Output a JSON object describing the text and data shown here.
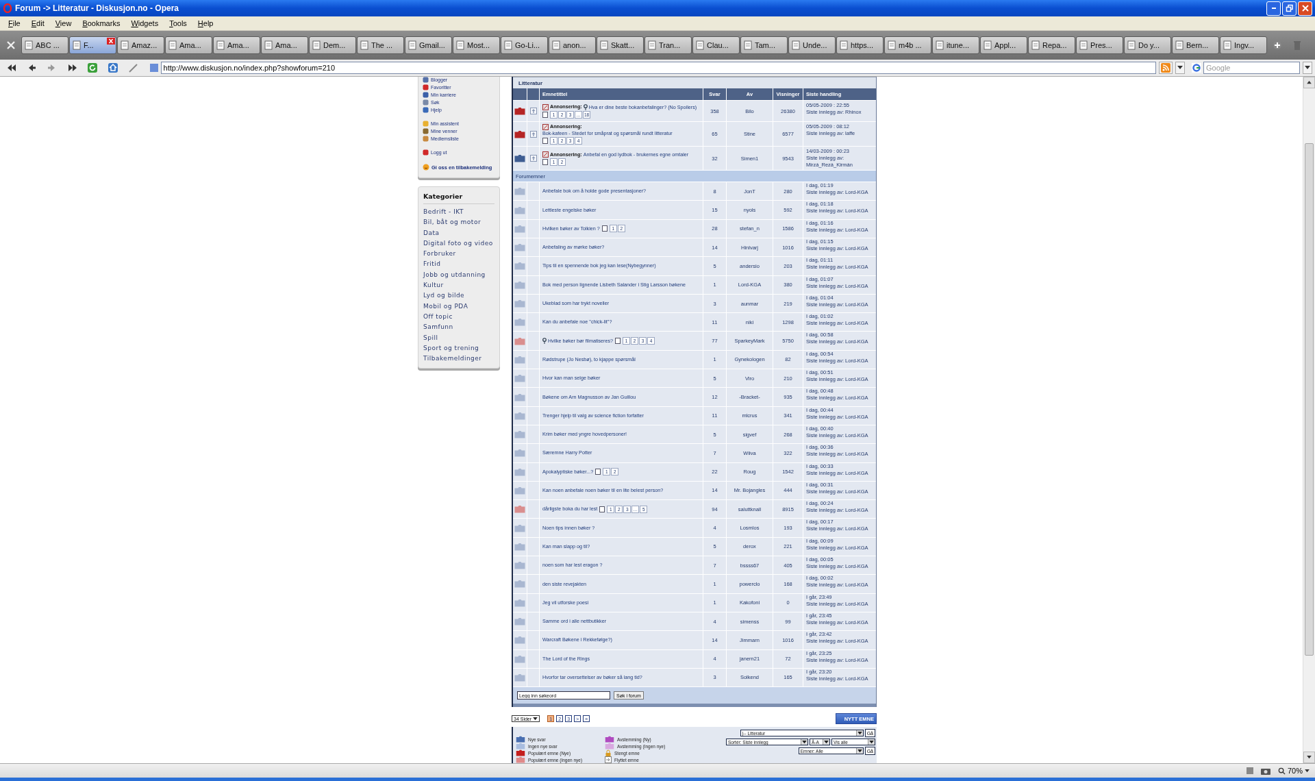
{
  "window": {
    "title": "Forum -> Litteratur - Diskusjon.no - Opera"
  },
  "menu": [
    "File",
    "Edit",
    "View",
    "Bookmarks",
    "Widgets",
    "Tools",
    "Help"
  ],
  "tabs": [
    {
      "label": "ABC ...",
      "selected": false
    },
    {
      "label": "F...",
      "selected": true
    },
    {
      "label": "Amaz...",
      "selected": false
    },
    {
      "label": "Ama...",
      "selected": false
    },
    {
      "label": "Ama...",
      "selected": false
    },
    {
      "label": "Ama...",
      "selected": false
    },
    {
      "label": "Dem...",
      "selected": false
    },
    {
      "label": "The ...",
      "selected": false
    },
    {
      "label": "Gmail...",
      "selected": false
    },
    {
      "label": "Most...",
      "selected": false
    },
    {
      "label": "Go-Li...",
      "selected": false
    },
    {
      "label": "anon...",
      "selected": false
    },
    {
      "label": "Skatt...",
      "selected": false
    },
    {
      "label": "Tran...",
      "selected": false
    },
    {
      "label": "Clau...",
      "selected": false
    },
    {
      "label": "Tam...",
      "selected": false
    },
    {
      "label": "Unde...",
      "selected": false
    },
    {
      "label": "https...",
      "selected": false
    },
    {
      "label": "m4b ...",
      "selected": false
    },
    {
      "label": "itune...",
      "selected": false
    },
    {
      "label": "Appl...",
      "selected": false
    },
    {
      "label": "Repa...",
      "selected": false
    },
    {
      "label": "Pres...",
      "selected": false
    },
    {
      "label": "Do y...",
      "selected": false
    },
    {
      "label": "Bern...",
      "selected": false
    },
    {
      "label": "Ingv...",
      "selected": false
    }
  ],
  "address": {
    "url": "http://www.diskusjon.no/index.php?showforum=210",
    "search_placeholder": "Google"
  },
  "sidebar": {
    "link_groups": [
      {
        "items": [
          "Blogger",
          "Favoritter",
          "Min karriere",
          "Søk",
          "Hjelp"
        ]
      },
      {
        "items": [
          "Min assistent",
          "Mine venner",
          "Medlemsliste"
        ]
      },
      {
        "items": [
          "Logg ut"
        ]
      }
    ],
    "feedback": "Gi oss en tilbakemelding",
    "categories_title": "Kategorier",
    "categories": [
      "Bedrift - IKT",
      "Bil, båt og motor",
      "Data",
      "Digital foto og video",
      "Forbruker",
      "Fritid",
      "Jobb og utdanning",
      "Kultur",
      "Lyd og bilde",
      "Mobil og PDA",
      "Off topic",
      "Samfunn",
      "Spill",
      "Sport og trening",
      "Tilbakemeldinger"
    ]
  },
  "forum": {
    "title": "Litteratur",
    "columns": [
      "Emnetittel",
      "Svar",
      "Av",
      "Visninger",
      "Siste handling"
    ],
    "announcements": [
      {
        "prefix": "Annonsering:",
        "title": "Hva er dine beste bokanbefalinger? (No Spoilers)",
        "pages": [
          "1",
          "2",
          "3",
          "…",
          "18"
        ],
        "replies": "358",
        "author": "Bilo",
        "views": "26380",
        "last_date": "05/05-2009 : 22:55",
        "last_by": "Siste innlegg av: Rhinox",
        "color": "#b52424",
        "flagged": true
      },
      {
        "prefix": "Annonsering:",
        "title": "Bok-kafeen - Stedet for småprat og spørsmål rundt litteratur",
        "pages": [
          "1",
          "2",
          "3",
          "4"
        ],
        "replies": "65",
        "author": "Stine",
        "views": "6577",
        "last_date": "05/05-2009 : 08:12",
        "last_by": "Siste innlegg av: laffe",
        "color": "#b52424",
        "flagged": false
      },
      {
        "prefix": "Annonsering:",
        "title": "Anbefal en god lydbok - brukernes egne omtaler",
        "pages": [
          "1",
          "2"
        ],
        "replies": "32",
        "author": "Simen1",
        "views": "9543",
        "last_date": "14/03-2009 : 00:23",
        "last_by": "Siste innlegg av: Mirzá_Rezá_Kirmán",
        "color": "#3e5d92",
        "flagged": false
      }
    ],
    "section": "Forumemner",
    "topics": [
      {
        "title": "Anbefale bok om å holde gode presentasjoner?",
        "replies": "8",
        "author": "JonT",
        "views": "280",
        "last_date": "I dag, 01:19",
        "last_by": "Siste innlegg av: Lord-KGA",
        "color": "#a9b7d1",
        "flagged": false
      },
      {
        "title": "Lettleste engelske bøker",
        "replies": "15",
        "author": "nyols",
        "views": "592",
        "last_date": "I dag, 01:18",
        "last_by": "Siste innlegg av: Lord-KGA",
        "color": "#a9b7d1",
        "flagged": false
      },
      {
        "title": "Hvilken bøker av Tolkien ?",
        "pages": [
          "1",
          "2"
        ],
        "replies": "28",
        "author": "stefan_n",
        "views": "1586",
        "last_date": "I dag, 01:16",
        "last_by": "Siste innlegg av: Lord-KGA",
        "color": "#a9b7d1",
        "flagged": false
      },
      {
        "title": "Anbefaling av mørke bøker?",
        "replies": "14",
        "author": "Hinlvarj",
        "views": "1016",
        "last_date": "I dag, 01:15",
        "last_by": "Siste innlegg av: Lord-KGA",
        "color": "#a9b7d1",
        "flagged": false
      },
      {
        "title": "Tips til en spennende bok jeg kan lese(Nybegynner)",
        "replies": "5",
        "author": "andersio",
        "views": "203",
        "last_date": "I dag, 01:11",
        "last_by": "Siste innlegg av: Lord-KGA",
        "color": "#a9b7d1",
        "flagged": false
      },
      {
        "title": "Bok med person lignende Lisbeth Salander i Stig Larsson bøkene",
        "replies": "1",
        "author": "Lord-KGA",
        "views": "380",
        "last_date": "I dag, 01:07",
        "last_by": "Siste innlegg av: Lord-KGA",
        "color": "#a9b7d1",
        "flagged": false
      },
      {
        "title": "Ukeblad som har trykt noveller",
        "replies": "3",
        "author": "aunmar",
        "views": "219",
        "last_date": "I dag, 01:04",
        "last_by": "Siste innlegg av: Lord-KGA",
        "color": "#a9b7d1",
        "flagged": false
      },
      {
        "title": "Kan du anbefale noe \"chick-lit\"?",
        "replies": "11",
        "author": "niki",
        "views": "1298",
        "last_date": "I dag, 01:02",
        "last_by": "Siste innlegg av: Lord-KGA",
        "color": "#a9b7d1",
        "flagged": false
      },
      {
        "title": "Hvilke bøker bør filmatiseres?",
        "pages": [
          "1",
          "2",
          "3",
          "4"
        ],
        "replies": "77",
        "author": "SparkeyMark",
        "views": "5750",
        "last_date": "I dag, 00:58",
        "last_by": "Siste innlegg av: Lord-KGA",
        "color": "#d98e8e",
        "flagged": true
      },
      {
        "title": "Rødstrupe (Jo Nesbø), to kjappe spørsmål",
        "replies": "1",
        "author": "Gynekologen",
        "views": "82",
        "last_date": "I dag, 00:54",
        "last_by": "Siste innlegg av: Lord-KGA",
        "color": "#a9b7d1",
        "flagged": false
      },
      {
        "title": "Hvor kan man selge bøker",
        "replies": "5",
        "author": "Viro",
        "views": "210",
        "last_date": "I dag, 00:51",
        "last_by": "Siste innlegg av: Lord-KGA",
        "color": "#a9b7d1",
        "flagged": false
      },
      {
        "title": "Bøkene om Arn Magnusson av Jan Guillou",
        "replies": "12",
        "author": "-Bracket-",
        "views": "935",
        "last_date": "I dag, 00:48",
        "last_by": "Siste innlegg av: Lord-KGA",
        "color": "#a9b7d1",
        "flagged": false
      },
      {
        "title": "Trenger hjelp til valg av science fiction forfatter",
        "replies": "11",
        "author": "mlcrus",
        "views": "341",
        "last_date": "I dag, 00:44",
        "last_by": "Siste innlegg av: Lord-KGA",
        "color": "#a9b7d1",
        "flagged": false
      },
      {
        "title": "Krim bøker med yngre hovedpersoner!",
        "replies": "5",
        "author": "sigvef",
        "views": "268",
        "last_date": "I dag, 00:40",
        "last_by": "Siste innlegg av: Lord-KGA",
        "color": "#a9b7d1",
        "flagged": false
      },
      {
        "title": "Særemne Harry Potter",
        "replies": "7",
        "author": "Wiiva",
        "views": "322",
        "last_date": "I dag, 00:36",
        "last_by": "Siste innlegg av: Lord-KGA",
        "color": "#a9b7d1",
        "flagged": false
      },
      {
        "title": "Apokalyptiske bøker...?",
        "pages": [
          "1",
          "2"
        ],
        "replies": "22",
        "author": "Roug",
        "views": "1542",
        "last_date": "I dag, 00:33",
        "last_by": "Siste innlegg av: Lord-KGA",
        "color": "#a9b7d1",
        "flagged": false
      },
      {
        "title": "Kan noen anbefale noen bøker til en lite belest person?",
        "replies": "14",
        "author": "Mr. Bojangles",
        "views": "444",
        "last_date": "I dag, 00:31",
        "last_by": "Siste innlegg av: Lord-KGA",
        "color": "#a9b7d1",
        "flagged": false
      },
      {
        "title": "dårligste boka du har lest",
        "pages": [
          "1",
          "2",
          "3",
          "…",
          "5"
        ],
        "replies": "94",
        "author": "saluttknall",
        "views": "8915",
        "last_date": "I dag, 00:24",
        "last_by": "Siste innlegg av: Lord-KGA",
        "color": "#d98e8e",
        "flagged": false
      },
      {
        "title": "Noen tips innen bøker ?",
        "replies": "4",
        "author": "Losmlos",
        "views": "193",
        "last_date": "I dag, 00:17",
        "last_by": "Siste innlegg av: Lord-KGA",
        "color": "#a9b7d1",
        "flagged": false
      },
      {
        "title": "Kan man slapp og til?",
        "replies": "5",
        "author": "derox",
        "views": "221",
        "last_date": "I dag, 00:09",
        "last_by": "Siste innlegg av: Lord-KGA",
        "color": "#a9b7d1",
        "flagged": false
      },
      {
        "title": "noen som har lest eragon ?",
        "replies": "7",
        "author": "bssss67",
        "views": "405",
        "last_date": "I dag, 00:05",
        "last_by": "Siste innlegg av: Lord-KGA",
        "color": "#a9b7d1",
        "flagged": false
      },
      {
        "title": "den siste revejakten",
        "replies": "1",
        "author": "powerclo",
        "views": "168",
        "last_date": "I dag, 00:02",
        "last_by": "Siste innlegg av: Lord-KGA",
        "color": "#a9b7d1",
        "flagged": false
      },
      {
        "title": "Jeg vil utforske poesi",
        "replies": "1",
        "author": "Kakofoni",
        "views": "0",
        "last_date": "I går, 23:49",
        "last_by": "Siste innlegg av: Lord-KGA",
        "color": "#a9b7d1",
        "flagged": false
      },
      {
        "title": "Samme ord i alle nettbutikker",
        "replies": "4",
        "author": "simenss",
        "views": "99",
        "last_date": "I går, 23:45",
        "last_by": "Siste innlegg av: Lord-KGA",
        "color": "#a9b7d1",
        "flagged": false
      },
      {
        "title": "Warcraft Bøkene i Rekkefølge?)",
        "replies": "14",
        "author": "Jimmarn",
        "views": "1016",
        "last_date": "I går, 23:42",
        "last_by": "Siste innlegg av: Lord-KGA",
        "color": "#a9b7d1",
        "flagged": false
      },
      {
        "title": "The Lord of the Rings",
        "replies": "4",
        "author": "janern21",
        "views": "72",
        "last_date": "I går, 23:25",
        "last_by": "Siste innlegg av: Lord-KGA",
        "color": "#a9b7d1",
        "flagged": false
      },
      {
        "title": "Hvorfor tar oversettelser av bøker så lang tid?",
        "replies": "3",
        "author": "Solkend",
        "views": "165",
        "last_date": "I går, 23:20",
        "last_by": "Siste innlegg av: Lord-KGA",
        "color": "#a9b7d1",
        "flagged": false
      }
    ],
    "search": {
      "placeholder": "Legg inn søkeord",
      "button": "Søk i forum"
    }
  },
  "pagination": {
    "dropdown": "34 Sider",
    "pages": [
      {
        "label": "1",
        "selected": true
      },
      {
        "label": "2",
        "selected": false
      },
      {
        "label": "3",
        "selected": false
      },
      {
        "label": ">",
        "selected": false
      },
      {
        "label": "»",
        "selected": false
      }
    ]
  },
  "new_topic": "NYTT EMNE",
  "legend": [
    {
      "kind": "folder",
      "label": "Nye svar",
      "color": "#4a6fb0"
    },
    {
      "kind": "folder",
      "label": "Ingen nye svar",
      "color": "#a9bde0"
    },
    {
      "kind": "folder",
      "label": "Populært emne (Nye)",
      "color": "#c41e1e"
    },
    {
      "kind": "folder",
      "label": "Populært emne (Ingen nye)",
      "color": "#e08a8a"
    },
    {
      "kind": "folder",
      "label": "Avstemming (Ny)",
      "color": "#b04cc0"
    },
    {
      "kind": "folder",
      "label": "Avstemming (Ingen nye)",
      "color": "#d8a8e0"
    },
    {
      "kind": "lock",
      "label": "Stengt emne",
      "color": "#d89a20"
    },
    {
      "kind": "moved",
      "label": "Flyttet emne",
      "color": "#808080"
    }
  ],
  "jump": {
    "forum": "|-- Litteratur",
    "go": "Gå",
    "sort": "Sortér: Siste innlegg",
    "order": "Å-A",
    "show": "Vis alle",
    "topics": "Emner: Alle",
    "go2": "Gå"
  },
  "status": {
    "zoom": "70%"
  }
}
